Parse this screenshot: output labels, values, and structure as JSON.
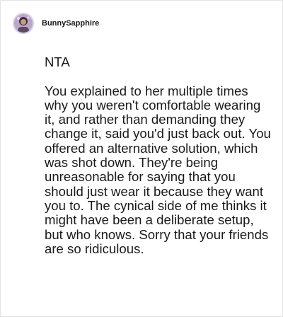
{
  "post": {
    "username": "BunnySapphire",
    "avatar_icon": "user-avatar-icon",
    "verdict": "NTA",
    "comment": "You explained to her multiple times why you weren't comfortable wearing it, and rather than demanding they change it, said you'd just back out. You offered an alternative solution, which was shot down. They're being unreasonable for saying that you should just wear it because they want you to. The cynical side of me thinks it might have been a deliberate setup, but who knows. Sorry that your friends are so ridiculous."
  },
  "colors": {
    "text": "#1a1a1a",
    "background": "#ffffff",
    "border": "#e3e3e3",
    "avatar_ring": "#d8cfe6"
  }
}
